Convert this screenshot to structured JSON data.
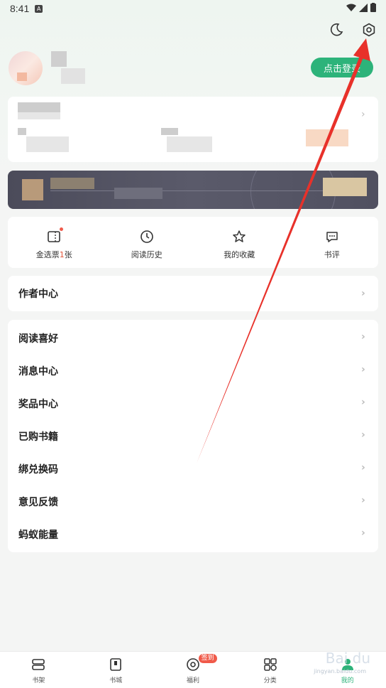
{
  "status": {
    "time": "8:41"
  },
  "header": {
    "theme_icon": "moon-icon",
    "settings_icon": "gear-icon"
  },
  "profile": {
    "login_label": "点击登录"
  },
  "quick_actions": [
    {
      "icon": "ticket-icon",
      "prefix": "金选票",
      "num": "1",
      "suffix": "张"
    },
    {
      "icon": "clock-icon",
      "label": "阅读历史"
    },
    {
      "icon": "star-icon",
      "label": "我的收藏"
    },
    {
      "icon": "comment-icon",
      "label": "书评"
    }
  ],
  "author_center": {
    "label": "作者中心"
  },
  "menu": [
    {
      "label": "阅读喜好"
    },
    {
      "label": "消息中心"
    },
    {
      "label": "奖品中心"
    },
    {
      "label": "已购书籍"
    },
    {
      "label": "绑兑换码"
    },
    {
      "label": "意见反馈"
    },
    {
      "label": "蚂蚁能量"
    }
  ],
  "bottom_nav": [
    {
      "label": "书架",
      "icon": "bookshelf-icon"
    },
    {
      "label": "书城",
      "icon": "bookstore-icon"
    },
    {
      "label": "福利",
      "icon": "gift-icon",
      "badge": "签到"
    },
    {
      "label": "分类",
      "icon": "category-icon"
    },
    {
      "label": "我的",
      "icon": "profile-icon",
      "active": true
    }
  ],
  "watermark": {
    "text": "Bai du",
    "sub": "jingyan.baidu.com"
  },
  "colors": {
    "accent": "#2db37a",
    "arrow": "#e8312a",
    "badge": "#f05a4a"
  }
}
